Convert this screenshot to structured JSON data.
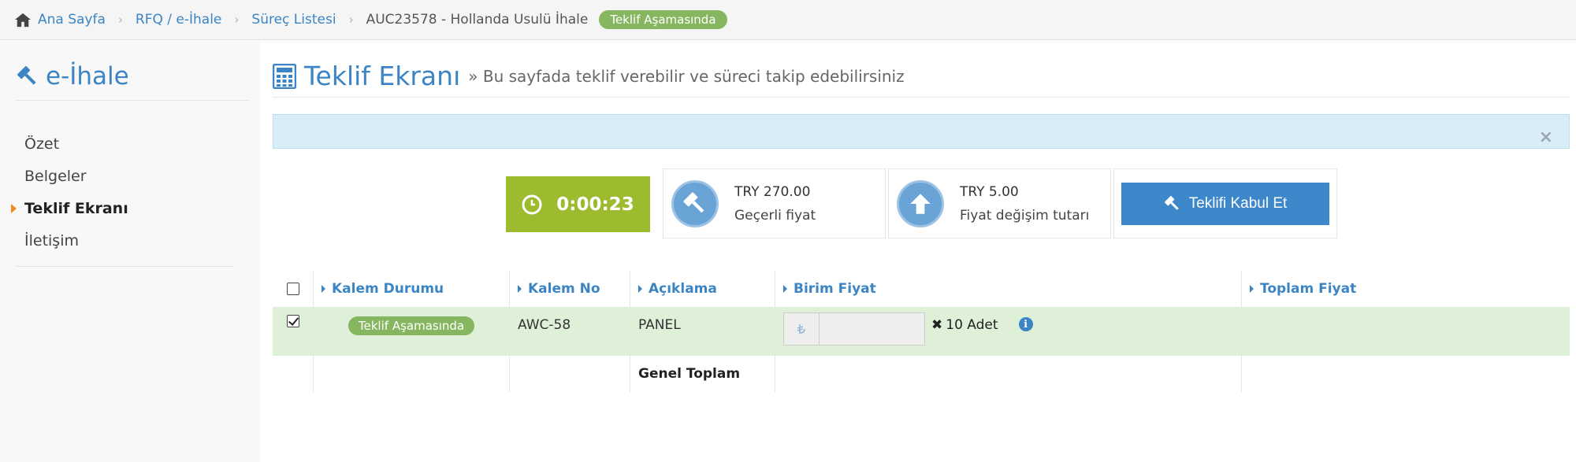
{
  "breadcrumb": {
    "items": [
      "Ana Sayfa",
      "RFQ / e-İhale",
      "Süreç Listesi"
    ],
    "current": "AUC23578 - Hollanda Usulü İhale",
    "status_badge": "Teklif Aşamasında"
  },
  "sidebar": {
    "brand": "e-İhale",
    "items": [
      {
        "label": "Özet",
        "active": false
      },
      {
        "label": "Belgeler",
        "active": false
      },
      {
        "label": "Teklif Ekranı",
        "active": true
      },
      {
        "label": "İletişim",
        "active": false
      }
    ]
  },
  "header": {
    "title": "Teklif Ekranı",
    "subtitle": "» Bu sayfada teklif verebilir ve süreci takip edebilirsiniz"
  },
  "alert": {
    "close_symbol": "×"
  },
  "timer": {
    "value": "0:00:23"
  },
  "stats": {
    "current_price_value": "TRY 270.00",
    "current_price_label": "Geçerli fiyat",
    "change_value": "TRY 5.00",
    "change_label": "Fiyat değişim tutarı"
  },
  "accept_button": {
    "label": "Teklifi Kabul Et"
  },
  "table": {
    "columns": [
      "Kalem Durumu",
      "Kalem No",
      "Açıklama",
      "Birim Fiyat",
      "Toplam Fiyat"
    ],
    "rows": [
      {
        "checked": true,
        "status": "Teklif Aşamasında",
        "item_no": "AWC-58",
        "description": "PANEL",
        "unit_price": "",
        "quantity_symbol": "✖",
        "quantity": "10 Adet",
        "total_price": ""
      }
    ],
    "total_label": "Genel Toplam"
  },
  "colors": {
    "accent": "#3b85c4",
    "badge_green": "#87b660",
    "timer_green": "#9cbb2f",
    "row_highlight": "#dff0d8",
    "alert_bg": "#d9edf7",
    "active_marker": "#f08a24"
  }
}
